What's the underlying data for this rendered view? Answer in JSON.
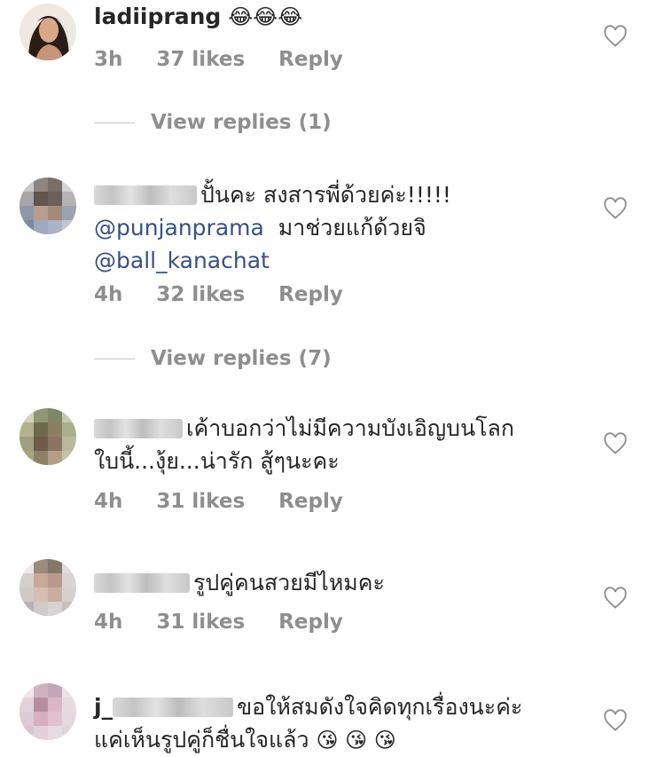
{
  "comments": [
    {
      "username": "ladiiprang",
      "text": "😂😂😂",
      "time": "3h",
      "likes": "37 likes",
      "reply": "Reply",
      "view_replies": "View replies (1)"
    },
    {
      "text_line1": "ปั้นคะ สงสารพี่ด้วยค่ะ!!!!!",
      "mention1": "@punjanprama",
      "text_line2": "มาช่วยแก้ด้วยจิ",
      "mention2": "@ball_kanachat",
      "time": "4h",
      "likes": "32 likes",
      "reply": "Reply",
      "view_replies": "View replies (7)"
    },
    {
      "text_line1": "เค้าบอกว่าไม่มีความบังเอิญบนโลก",
      "text_line2": "ใบนี้...งุ้ย...น่ารัก สู้ๆนะคะ",
      "time": "4h",
      "likes": "31 likes",
      "reply": "Reply"
    },
    {
      "text_line1": "รูปคู่คนสวยมีไหมคะ",
      "time": "4h",
      "likes": "31 likes",
      "reply": "Reply"
    },
    {
      "username_prefix": "j_",
      "text_line1": "ขอให้สมดังใจคิดทุกเรื่องนะค่ะ",
      "text_line2": "แค่เห็นรูปคู่ก็ชื่นใจแล้ว",
      "emoji": "😘 😘 😘"
    }
  ],
  "icons": {
    "heart": "heart-outline-icon"
  },
  "colors": {
    "text": "#262626",
    "meta": "#8e8e8e",
    "mention": "#385185"
  }
}
